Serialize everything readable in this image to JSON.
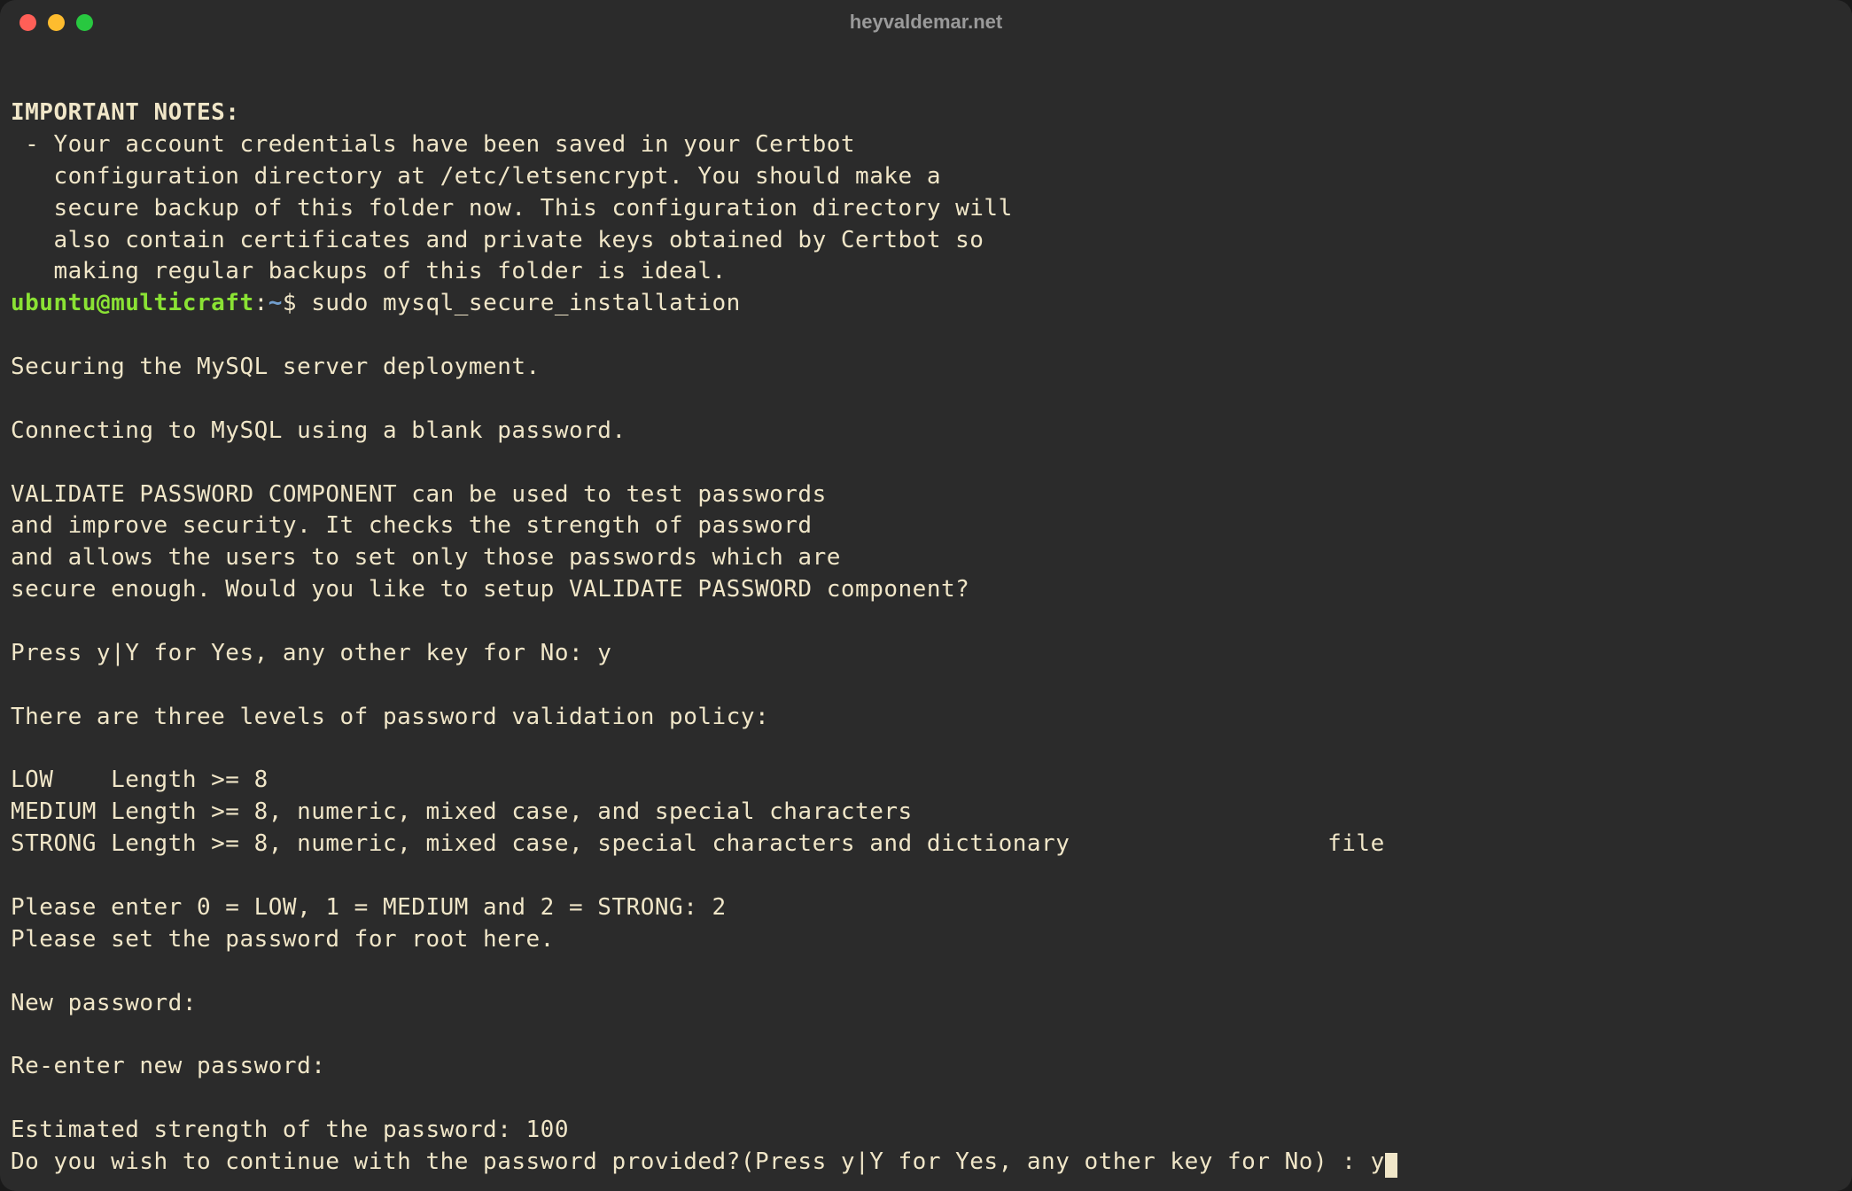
{
  "window": {
    "title": "heyvaldemar.net"
  },
  "terminal": {
    "heading": "IMPORTANT NOTES:",
    "note_line1": " - Your account credentials have been saved in your Certbot",
    "note_line2": "   configuration directory at /etc/letsencrypt. You should make a",
    "note_line3": "   secure backup of this folder now. This configuration directory will",
    "note_line4": "   also contain certificates and private keys obtained by Certbot so",
    "note_line5": "   making regular backups of this folder is ideal.",
    "prompt": {
      "user_host": "ubuntu@multicraft",
      "colon": ":",
      "path": "~",
      "symbol": "$ ",
      "command": "sudo mysql_secure_installation"
    },
    "blank": "",
    "sec1": "Securing the MySQL server deployment.",
    "sec2": "Connecting to MySQL using a blank password.",
    "vp1": "VALIDATE PASSWORD COMPONENT can be used to test passwords",
    "vp2": "and improve security. It checks the strength of password",
    "vp3": "and allows the users to set only those passwords which are",
    "vp4": "secure enough. Would you like to setup VALIDATE PASSWORD component?",
    "press_y": "Press y|Y for Yes, any other key for No: y",
    "levels_intro": "There are three levels of password validation policy:",
    "low": "LOW    Length >= 8",
    "medium": "MEDIUM Length >= 8, numeric, mixed case, and special characters",
    "strong": "STRONG Length >= 8, numeric, mixed case, special characters and dictionary                  file",
    "enter_level": "Please enter 0 = LOW, 1 = MEDIUM and 2 = STRONG: 2",
    "set_root": "Please set the password for root here.",
    "new_pw": "New password: ",
    "re_pw": "Re-enter new password: ",
    "strength": "Estimated strength of the password: 100 ",
    "continue_prompt": "Do you wish to continue with the password provided?(Press y|Y for Yes, any other key for No) : y"
  }
}
